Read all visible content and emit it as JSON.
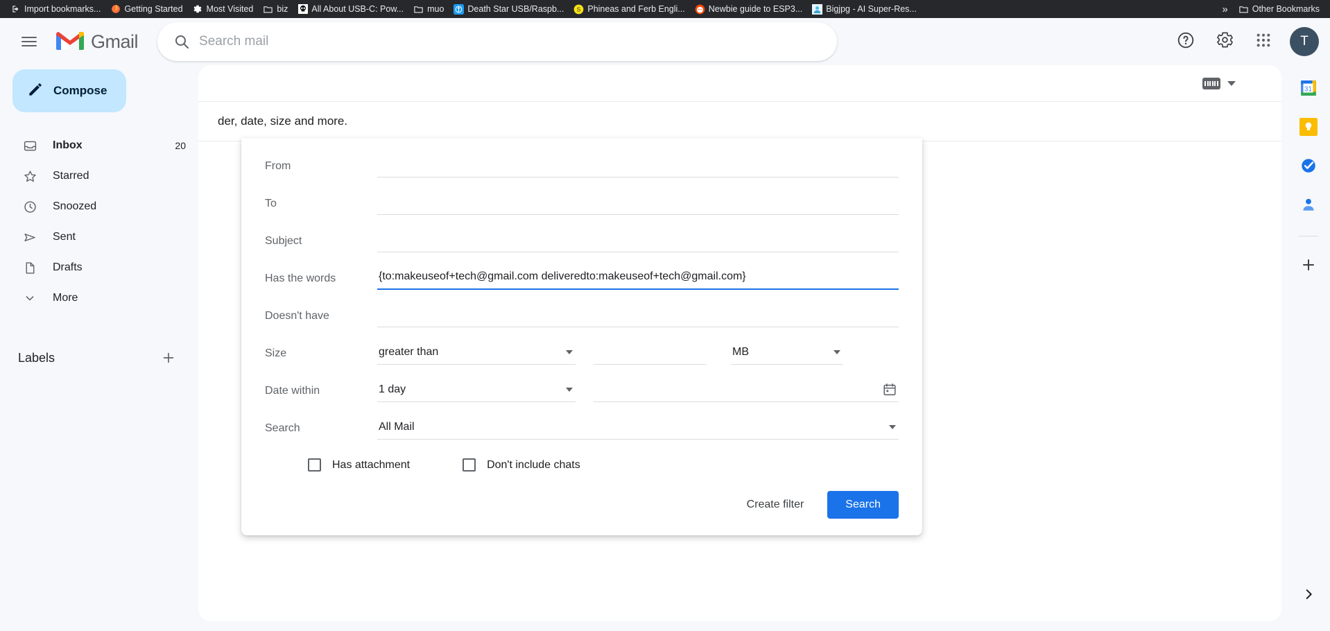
{
  "browser": {
    "bookmarks": [
      {
        "label": "Import bookmarks...",
        "icon": "import-icon"
      },
      {
        "label": "Getting Started",
        "icon": "firefox-icon"
      },
      {
        "label": "Most Visited",
        "icon": "gear-icon"
      },
      {
        "label": "biz",
        "icon": "folder-icon"
      },
      {
        "label": "All About USB-C: Pow...",
        "icon": "skull-icon"
      },
      {
        "label": "muo",
        "icon": "folder-icon"
      },
      {
        "label": "Death Star USB/Raspb...",
        "icon": "tumblr-icon"
      },
      {
        "label": "Phineas and Ferb Engli...",
        "icon": "yellow-s-icon"
      },
      {
        "label": "Newbie guide to ESP3...",
        "icon": "reddit-icon"
      },
      {
        "label": "Bigjpg - AI Super-Res...",
        "icon": "bigjpg-icon"
      }
    ],
    "overflow_label": "»",
    "other_bookmarks": {
      "label": "Other Bookmarks",
      "icon": "folder-icon"
    }
  },
  "header": {
    "menu_icon": "hamburger-icon",
    "logo_text": "Gmail",
    "search": {
      "placeholder": "Search mail",
      "value": "",
      "icon": "search-icon"
    },
    "actions": [
      {
        "name": "help-icon",
        "label": "Support"
      },
      {
        "name": "gear-icon",
        "label": "Settings"
      },
      {
        "name": "apps-grid-icon",
        "label": "Google apps"
      }
    ],
    "avatar_initial": "T"
  },
  "sidebar": {
    "compose": {
      "label": "Compose",
      "icon": "pencil-icon"
    },
    "items": [
      {
        "label": "Inbox",
        "icon": "inbox-icon",
        "count": "20",
        "active": true
      },
      {
        "label": "Starred",
        "icon": "star-icon",
        "count": ""
      },
      {
        "label": "Snoozed",
        "icon": "clock-icon",
        "count": ""
      },
      {
        "label": "Sent",
        "icon": "send-icon",
        "count": ""
      },
      {
        "label": "Drafts",
        "icon": "draft-icon",
        "count": ""
      },
      {
        "label": "More",
        "icon": "chevron-down-icon",
        "count": ""
      }
    ],
    "labels": {
      "title": "Labels",
      "add_icon": "plus-icon"
    }
  },
  "main": {
    "keyboard_chip": {
      "icon": "keyboard-icon",
      "caret": "chevron-down-icon"
    },
    "note": "der, date, size and more."
  },
  "right_rail": {
    "items": [
      {
        "name": "calendar-icon",
        "label": "Calendar",
        "badge": "31"
      },
      {
        "name": "keep-icon",
        "label": "Keep"
      },
      {
        "name": "tasks-icon",
        "label": "Tasks"
      },
      {
        "name": "contacts-icon",
        "label": "Contacts"
      }
    ],
    "add_icon": "plus-icon",
    "expand_icon": "chevron-right-icon"
  },
  "advanced_search": {
    "fields": {
      "from": {
        "label": "From",
        "value": "",
        "placeholder": ""
      },
      "to": {
        "label": "To",
        "value": "",
        "placeholder": ""
      },
      "subject": {
        "label": "Subject",
        "value": "",
        "placeholder": ""
      },
      "has_words": {
        "label": "Has the words",
        "value": "{to:makeuseof+tech@gmail.com deliveredto:makeuseof+tech@gmail.com}",
        "placeholder": ""
      },
      "doesnt_have": {
        "label": "Doesn't have",
        "value": "",
        "placeholder": ""
      },
      "size": {
        "label": "Size",
        "comparator": "greater than",
        "amount": "",
        "unit": "MB"
      },
      "date_within": {
        "label": "Date within",
        "range": "1 day",
        "date": "",
        "calendar_icon": "calendar-picker-icon"
      },
      "search_scope": {
        "label": "Search",
        "value": "All Mail"
      }
    },
    "checkboxes": [
      {
        "label": "Has attachment",
        "checked": false
      },
      {
        "label": "Don't include chats",
        "checked": false
      }
    ],
    "buttons": {
      "create_filter": "Create filter",
      "search": "Search"
    }
  },
  "colors": {
    "accent": "#1a73e8",
    "compose_bg": "#c2e7ff",
    "page_bg": "#f6f8fc",
    "bookmark_bar_bg": "#26282c"
  }
}
